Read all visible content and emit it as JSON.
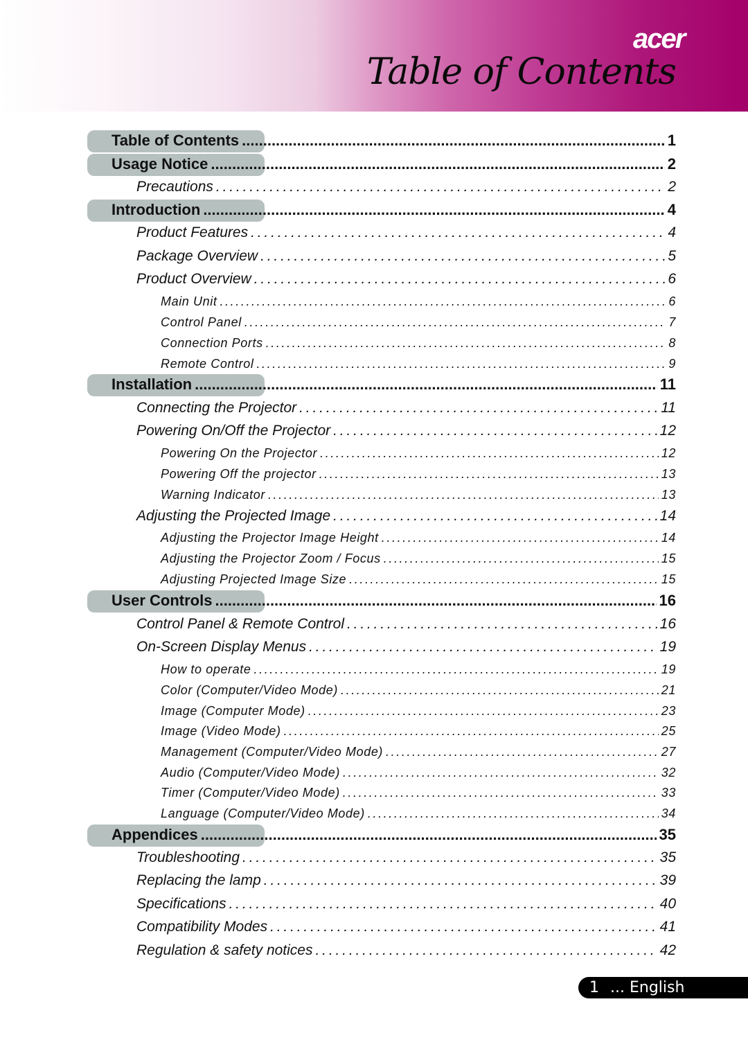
{
  "header": {
    "brand": "acer",
    "title": "Table of Contents",
    "colors": {
      "gradient_start": "#ffffff",
      "gradient_mid": "#df99c6",
      "gradient_end": "#a4006a",
      "section_pill": "#b6c0bf"
    }
  },
  "toc": [
    {
      "level": 1,
      "label": "Table of Contents",
      "page": "1"
    },
    {
      "level": 1,
      "label": "Usage Notice",
      "page": "2"
    },
    {
      "level": 2,
      "label": "Precautions",
      "page": "2"
    },
    {
      "level": 1,
      "label": "Introduction",
      "page": "4"
    },
    {
      "level": 2,
      "label": "Product Features",
      "page": "4"
    },
    {
      "level": 2,
      "label": "Package Overview",
      "page": "5"
    },
    {
      "level": 2,
      "label": "Product Overview",
      "page": "6"
    },
    {
      "level": 3,
      "label": "Main Unit",
      "page": "6"
    },
    {
      "level": 3,
      "label": "Control Panel",
      "page": "7"
    },
    {
      "level": 3,
      "label": "Connection Ports",
      "page": "8"
    },
    {
      "level": 3,
      "label": "Remote Control",
      "page": "9"
    },
    {
      "level": 1,
      "label": "Installation",
      "page": "11"
    },
    {
      "level": 2,
      "label": "Connecting the Projector",
      "page": "11"
    },
    {
      "level": 2,
      "label": "Powering On/Off the Projector",
      "page": "12"
    },
    {
      "level": 3,
      "label": "Powering On the Projector",
      "page": "12"
    },
    {
      "level": 3,
      "label": "Powering Off the projector",
      "page": "13"
    },
    {
      "level": 3,
      "label": "Warning Indicator",
      "page": "13"
    },
    {
      "level": 2,
      "label": "Adjusting the Projected Image",
      "page": "14"
    },
    {
      "level": 3,
      "label": "Adjusting the Projector Image Height",
      "page": "14"
    },
    {
      "level": 3,
      "label": "Adjusting the Projector Zoom / Focus",
      "page": "15"
    },
    {
      "level": 3,
      "label": "Adjusting Projected Image Size",
      "page": "15"
    },
    {
      "level": 1,
      "label": "User Controls",
      "page": "16"
    },
    {
      "level": 2,
      "label": "Control Panel & Remote Control",
      "page": "16"
    },
    {
      "level": 2,
      "label": "On-Screen Display Menus",
      "page": "19"
    },
    {
      "level": 3,
      "label": "How to operate",
      "page": "19"
    },
    {
      "level": 3,
      "label": "Color (Computer/Video Mode)",
      "page": "21"
    },
    {
      "level": 3,
      "label": "Image (Computer Mode)",
      "page": "23"
    },
    {
      "level": 3,
      "label": "Image (Video Mode)",
      "page": "25"
    },
    {
      "level": 3,
      "label": "Management (Computer/Video Mode)",
      "page": "27"
    },
    {
      "level": 3,
      "label": "Audio (Computer/Video Mode)",
      "page": "32"
    },
    {
      "level": 3,
      "label": "Timer (Computer/Video Mode)",
      "page": "33"
    },
    {
      "level": 3,
      "label": "Language (Computer/Video Mode)",
      "page": "34"
    },
    {
      "level": 1,
      "label": "Appendices",
      "page": "35"
    },
    {
      "level": 2,
      "label": "Troubleshooting",
      "page": "35"
    },
    {
      "level": 2,
      "label": "Replacing the lamp",
      "page": "39"
    },
    {
      "level": 2,
      "label": "Specifications",
      "page": "40"
    },
    {
      "level": 2,
      "label": "Compatibility Modes",
      "page": "41"
    },
    {
      "level": 2,
      "label": "Regulation & safety notices",
      "page": "42"
    }
  ],
  "footer": {
    "page_number": "1",
    "language": "... English"
  }
}
